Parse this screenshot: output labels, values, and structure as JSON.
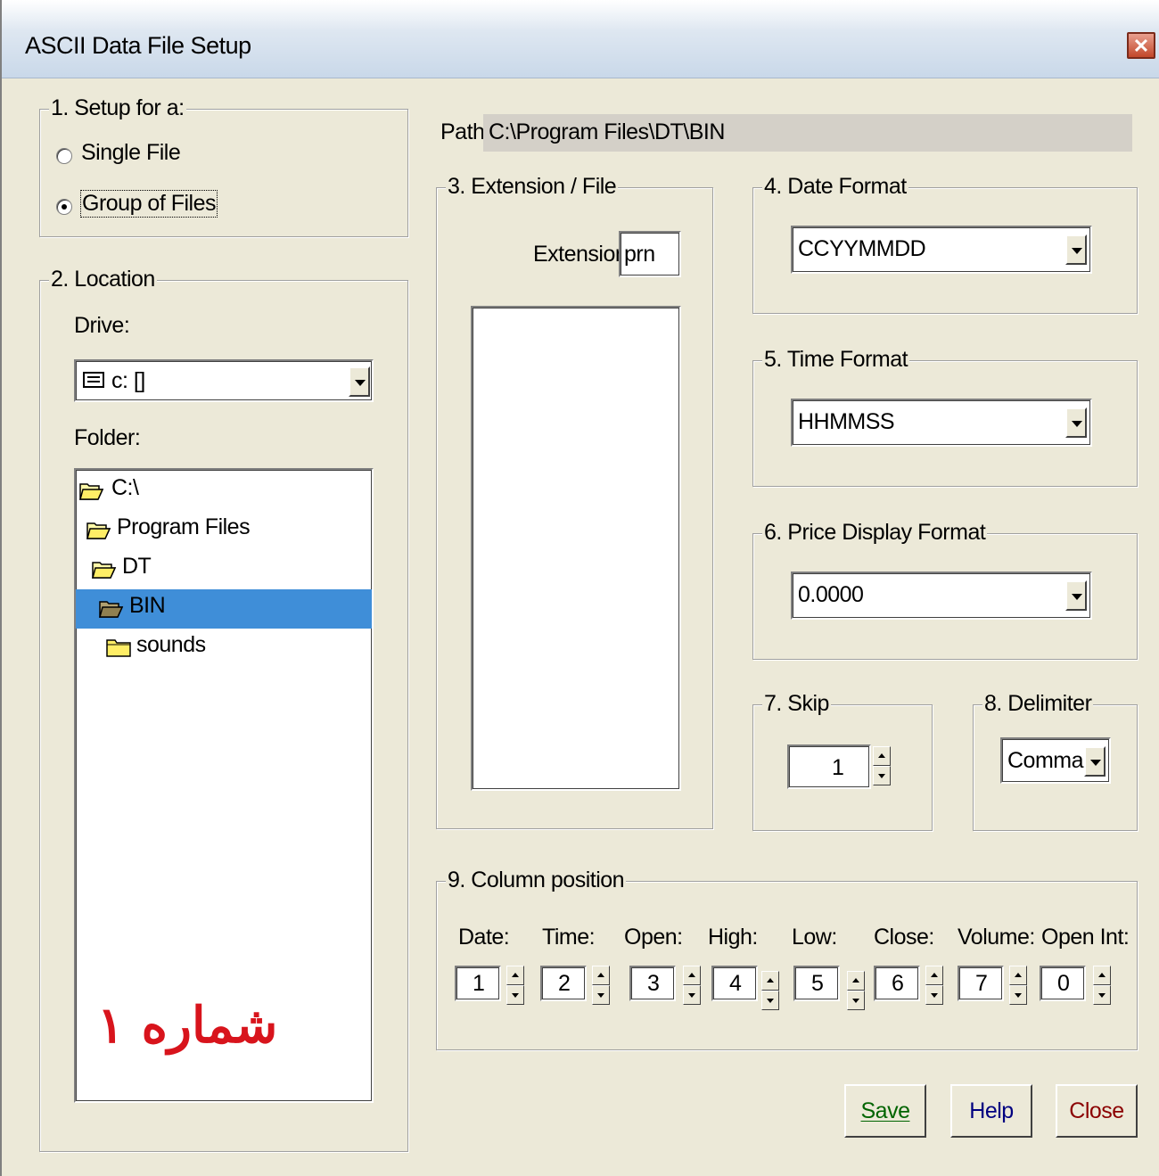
{
  "window": {
    "title": "ASCII Data File Setup"
  },
  "setup_group": {
    "legend": "1. Setup for a:",
    "options": [
      {
        "label": "Single File",
        "checked": false
      },
      {
        "label": "Group of Files",
        "checked": true
      }
    ]
  },
  "location_group": {
    "legend": "2. Location",
    "drive_label": "Drive:",
    "drive_value": "c: []",
    "folder_label": "Folder:",
    "folders": [
      {
        "name": "C:\\",
        "state": "open"
      },
      {
        "name": "Program Files",
        "state": "open"
      },
      {
        "name": "DT",
        "state": "open"
      },
      {
        "name": "BIN",
        "state": "open-selected"
      },
      {
        "name": "sounds",
        "state": "closed"
      }
    ],
    "watermark": "شماره ۱"
  },
  "path": {
    "label": "Path:",
    "value": "C:\\Program Files\\DT\\BIN"
  },
  "extension_group": {
    "legend": "3. Extension / File",
    "extension_label": "Extension:",
    "extension_value": "prn"
  },
  "date_format": {
    "legend": "4. Date Format",
    "value": "CCYYMMDD"
  },
  "time_format": {
    "legend": "5. Time Format",
    "value": "HHMMSS"
  },
  "price_format": {
    "legend": "6. Price Display Format",
    "value": "0.0000"
  },
  "skip": {
    "legend": "7. Skip",
    "value": "1"
  },
  "delimiter": {
    "legend": "8. Delimiter",
    "value": "Comma"
  },
  "columns": {
    "legend": "9. Column position",
    "items": [
      {
        "label": "Date:",
        "value": "1"
      },
      {
        "label": "Time:",
        "value": "2"
      },
      {
        "label": "Open:",
        "value": "3"
      },
      {
        "label": "High:",
        "value": "4"
      },
      {
        "label": "Low:",
        "value": "5"
      },
      {
        "label": "Close:",
        "value": "6"
      },
      {
        "label": "Volume:",
        "value": "7"
      },
      {
        "label": "Open Int:",
        "value": "0"
      }
    ]
  },
  "buttons": {
    "save": "Save",
    "help": "Help",
    "close": "Close"
  },
  "colors": {
    "selection": "#3f8ed8",
    "save_text": "#006400",
    "help_text": "#000080",
    "close_text": "#8b0000",
    "watermark": "#d8141c"
  }
}
